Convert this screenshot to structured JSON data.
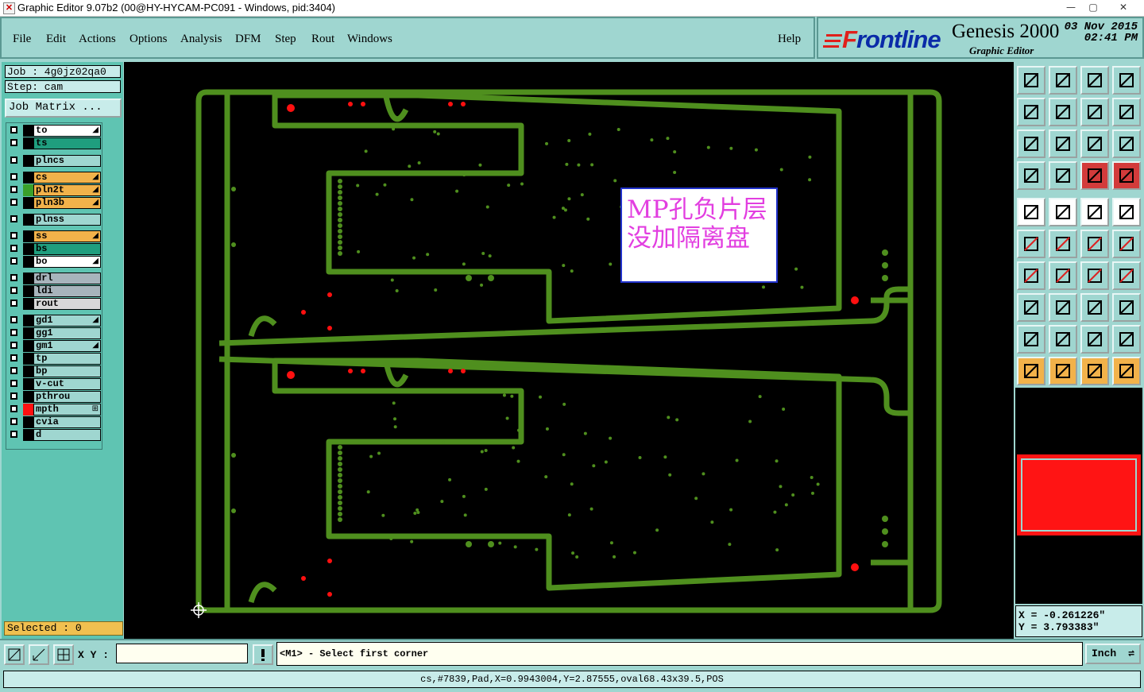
{
  "window": {
    "title": "Graphic Editor 9.07b2 (00@HY-HYCAM-PC091 - Windows, pid:3404)",
    "controls": [
      "—",
      "▢",
      "✕"
    ]
  },
  "menu": {
    "items": [
      "File",
      "Edit",
      "Actions",
      "Options",
      "Analysis",
      "DFM",
      "Step",
      "Rout",
      "Windows"
    ],
    "help": "Help"
  },
  "brand": {
    "logo_f": "F",
    "logo_rest": "rontline",
    "product": "Genesis 2000",
    "subtitle": "Graphic Editor",
    "date": "03 Nov 2015",
    "time": "02:41 PM"
  },
  "job": {
    "job_label": "Job : 4g0jz02qa0",
    "step_label": "Step: cam",
    "matrix_button": "Job Matrix ..."
  },
  "layers": [
    {
      "name": "to",
      "bg": "#ffffff",
      "swatch": "#000000",
      "flag": "◢"
    },
    {
      "name": "ts",
      "bg": "#1f9e7e",
      "swatch": "#000000",
      "flag": ""
    },
    {
      "name": "plncs",
      "bg": "#9fd6d0",
      "swatch": "#000000",
      "flag": ""
    },
    {
      "name": "cs",
      "bg": "#f2b24a",
      "swatch": "#000000",
      "flag": "◢"
    },
    {
      "name": "pln2t",
      "bg": "#f2b24a",
      "swatch": "#3aa02a",
      "flag": "◢"
    },
    {
      "name": "pln3b",
      "bg": "#f2b24a",
      "swatch": "#000000",
      "flag": "◢"
    },
    {
      "name": "plnss",
      "bg": "#9fd6d0",
      "swatch": "#000000",
      "flag": ""
    },
    {
      "name": "ss",
      "bg": "#f2b24a",
      "swatch": "#000000",
      "flag": "◢"
    },
    {
      "name": "bs",
      "bg": "#1f9e7e",
      "swatch": "#000000",
      "flag": ""
    },
    {
      "name": "bo",
      "bg": "#ffffff",
      "swatch": "#000000",
      "flag": "◢"
    },
    {
      "name": "drl",
      "bg": "#a8b4bc",
      "swatch": "#000000",
      "flag": ""
    },
    {
      "name": "ldi",
      "bg": "#a8b4bc",
      "swatch": "#000000",
      "flag": ""
    },
    {
      "name": "rout",
      "bg": "#d8d8d8",
      "swatch": "#000000",
      "flag": ""
    },
    {
      "name": "gd1",
      "bg": "#9fd6d0",
      "swatch": "#000000",
      "flag": "◢"
    },
    {
      "name": "gg1",
      "bg": "#9fd6d0",
      "swatch": "#000000",
      "flag": ""
    },
    {
      "name": "gm1",
      "bg": "#9fd6d0",
      "swatch": "#000000",
      "flag": "◢"
    },
    {
      "name": "tp",
      "bg": "#9fd6d0",
      "swatch": "#000000",
      "flag": ""
    },
    {
      "name": "bp",
      "bg": "#9fd6d0",
      "swatch": "#000000",
      "flag": ""
    },
    {
      "name": "v-cut",
      "bg": "#9fd6d0",
      "swatch": "#000000",
      "flag": ""
    },
    {
      "name": "pthrou",
      "bg": "#9fd6d0",
      "swatch": "#000000",
      "flag": ""
    },
    {
      "name": "mpth",
      "bg": "#9fd6d0",
      "swatch": "#ff1010",
      "flag": "⊞"
    },
    {
      "name": "cvia",
      "bg": "#9fd6d0",
      "swatch": "#000000",
      "flag": ""
    },
    {
      "name": "d",
      "bg": "#9fd6d0",
      "swatch": "#000000",
      "flag": ""
    }
  ],
  "selected": "Selected : 0",
  "annotation": {
    "line1": "MP孔负片层",
    "line2": "没加隔离盘"
  },
  "coords": {
    "x": "X = -0.261226\"",
    "y": "Y = 3.793383\""
  },
  "bottom": {
    "xy_label": "X Y :",
    "xy_value": "",
    "prompt": "<M1> - Select first corner",
    "units": "Inch"
  },
  "status": "cs,#7839,Pad,X=0.9943004,Y=2.87555,oval68.43x39.5,POS",
  "colors": {
    "board": "#4f8f1e",
    "pad_red": "#ff1010",
    "panel_bg": "#9fd6d0"
  }
}
